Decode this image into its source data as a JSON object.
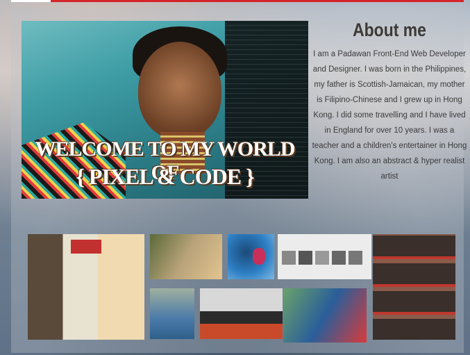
{
  "hero": {
    "title_line1": "WELCOME TO MY WORLD OF",
    "title_line2": "{ PIXEL & CODE }"
  },
  "about": {
    "title": "About me",
    "body": "I am a Padawan Front-End Web Developer and Designer. I was born in the Philippines, my father is Scottish-Jamaican, my mother is Filipino-Chinese and  I grew up in Hong Kong. I did some travelling and I have lived in England for over 10 years. I was a teacher and a children's entertainer in Hong Kong. I am also an abstract & hyper realist artist"
  },
  "gallery": {
    "items": [
      {
        "name": "classroom-display-photo"
      },
      {
        "name": "kids-crafting-photo"
      },
      {
        "name": "face-paint-portrait-photo"
      },
      {
        "name": "portfolio-screenshot-photo"
      },
      {
        "name": "face-paint-collage-photo"
      },
      {
        "name": "child-in-blue-photo"
      },
      {
        "name": "group-photo"
      },
      {
        "name": "clown-with-child-photo"
      }
    ]
  },
  "colors": {
    "accent_strip": "#d4242a",
    "title_text": "#3b3a34",
    "body_text": "#3a3a3a"
  }
}
